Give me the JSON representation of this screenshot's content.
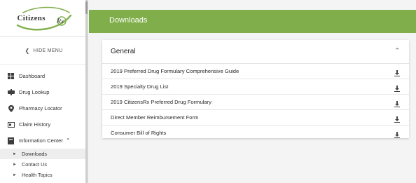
{
  "brand": {
    "logo_text": "Citizens",
    "logo_sub": "Rx",
    "accent": "#7fae4a"
  },
  "sidebar": {
    "hide_menu": "HIDE MENU",
    "items": [
      {
        "label": "Dashboard",
        "icon": "dashboard-icon"
      },
      {
        "label": "Drug Lookup",
        "icon": "pill-icon"
      },
      {
        "label": "Pharmacy Locator",
        "icon": "location-pin-icon"
      },
      {
        "label": "Claim History",
        "icon": "card-icon"
      },
      {
        "label": "Information Center",
        "icon": "book-icon"
      }
    ],
    "subitems": [
      {
        "label": "Downloads",
        "active": true
      },
      {
        "label": "Contact Us"
      },
      {
        "label": "Health Topics"
      }
    ]
  },
  "page": {
    "title": "Downloads"
  },
  "section": {
    "title": "General",
    "files": [
      {
        "label": "2019 Preferred Drug Formulary Comprehensive Guide"
      },
      {
        "label": "2019 Specialty Drug List"
      },
      {
        "label": "2019 CitizensRx Preferred Drug Formulary"
      },
      {
        "label": "Direct Member Reimbursement Form"
      },
      {
        "label": "Consumer Bill of Rights"
      }
    ]
  }
}
